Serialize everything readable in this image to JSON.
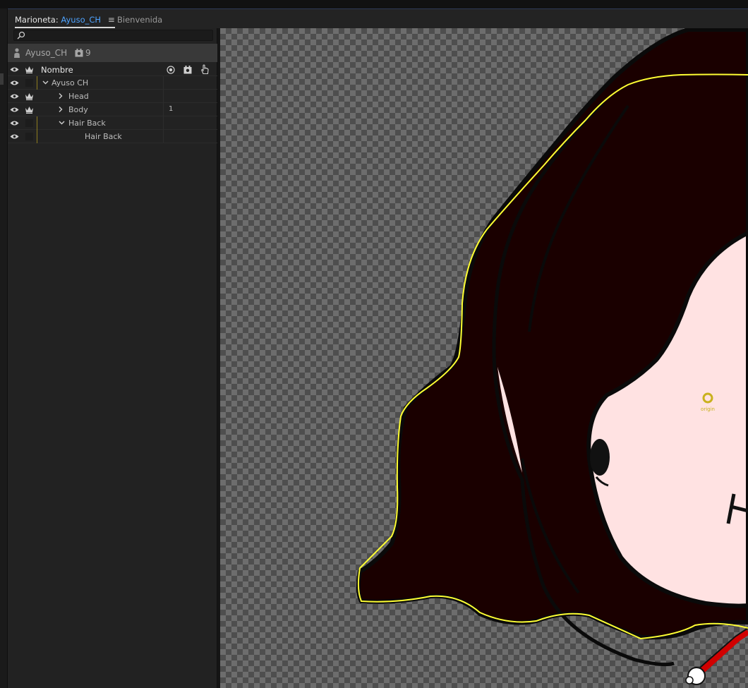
{
  "tabs": {
    "puppet_prefix": "Marioneta:",
    "puppet_name": "Ayuso_CH",
    "menu_glyph": "≡",
    "welcome": "Bienvenida"
  },
  "search": {
    "placeholder": "",
    "value": ""
  },
  "puppet_header": {
    "name": "Ayuso_CH",
    "scene_count": "9"
  },
  "tree": {
    "header": {
      "label": "Nombre"
    },
    "rows": [
      {
        "label": "Ayuso CH",
        "value": ""
      },
      {
        "label": "Head",
        "value": ""
      },
      {
        "label": "Body",
        "value": "1"
      },
      {
        "label": "Hair Back",
        "value": ""
      },
      {
        "label": "Hair Back",
        "value": ""
      }
    ]
  },
  "canvas": {
    "origin_label": "origin"
  },
  "colors": {
    "accent": "#4ea3ff",
    "selection_outline": "#ffff33",
    "hair": "#1a0000",
    "skin": "#ffe2e2"
  }
}
